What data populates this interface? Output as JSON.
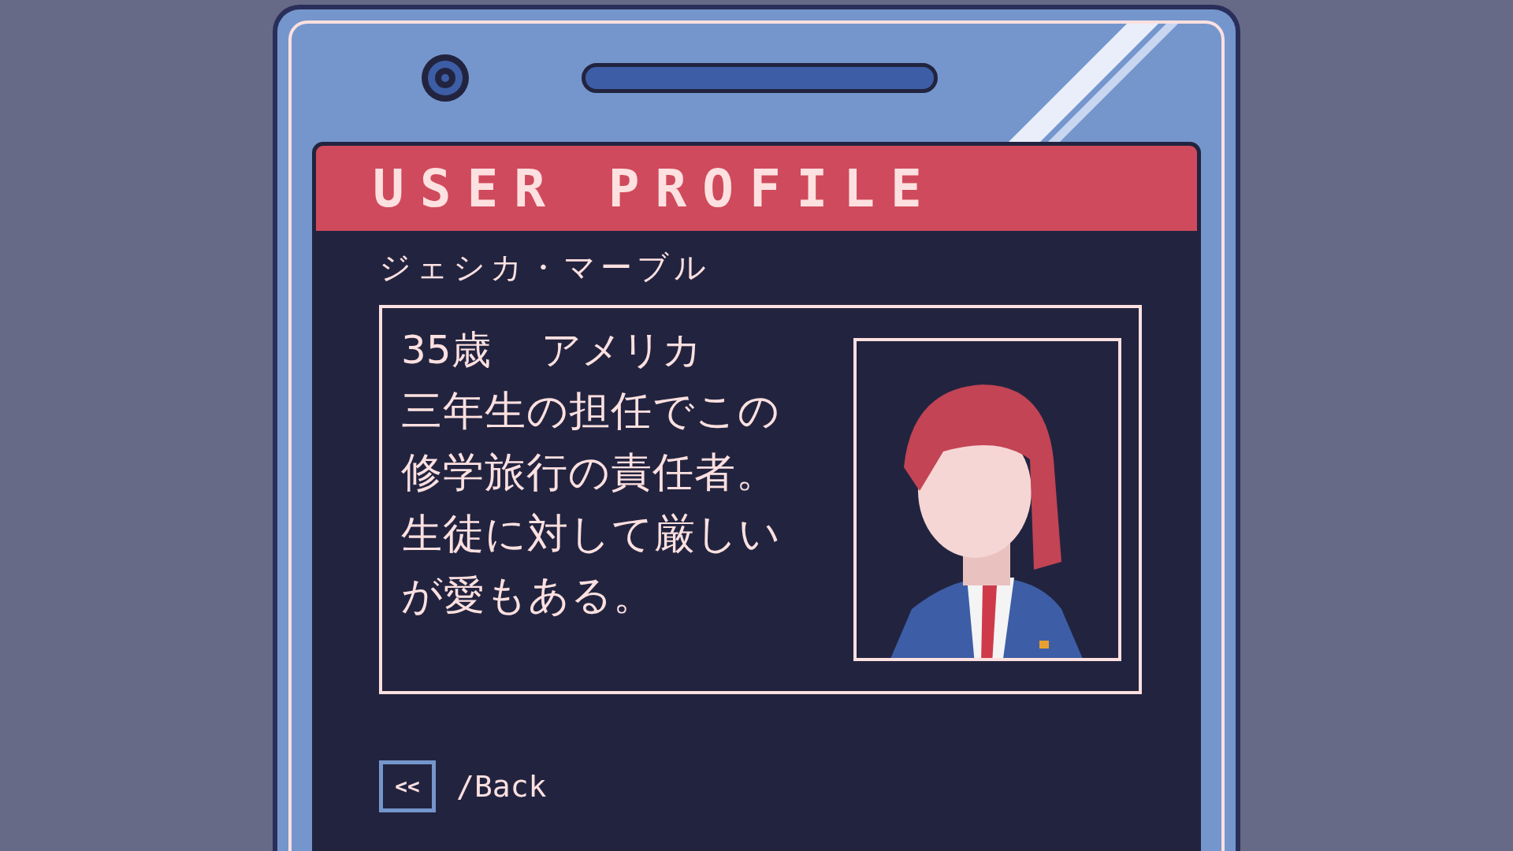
{
  "header": {
    "title": "USER PROFILE"
  },
  "profile": {
    "name": "ジェシカ・マーブル",
    "age": "35歳",
    "country": "アメリカ",
    "description": "三年生の担任でこの修学旅行の責任者。生徒に対して厳しいが愛もある。"
  },
  "back": {
    "icon_text": "<<",
    "label": "/Back"
  }
}
